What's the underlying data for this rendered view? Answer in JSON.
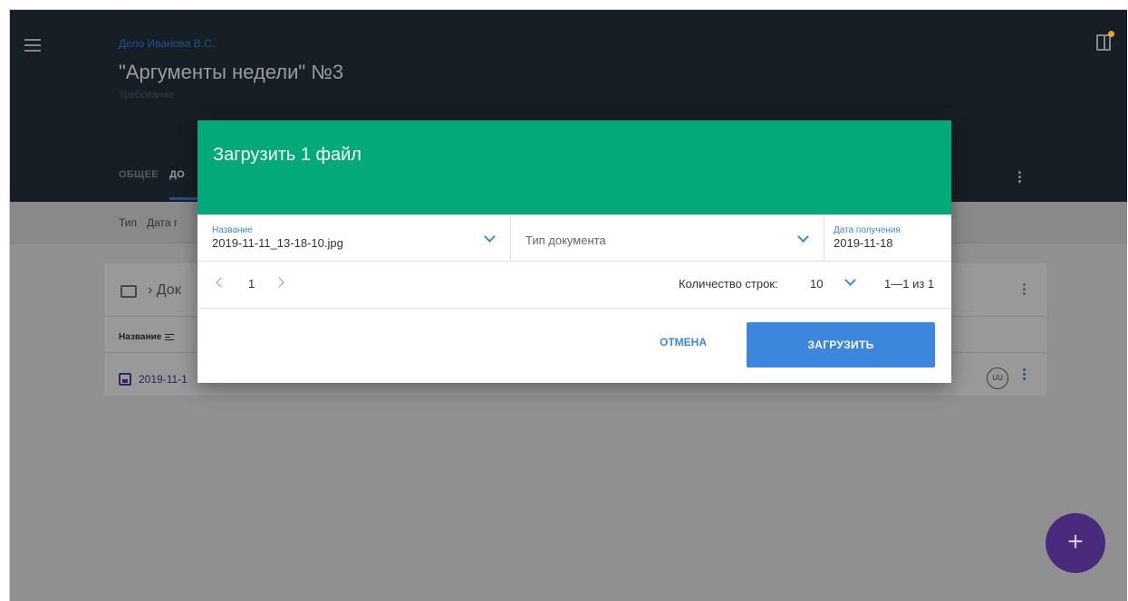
{
  "header": {
    "case_title": "Дело Иванова В.С.",
    "doc_title": "\"Аргументы недели\" №3",
    "doc_subtitle": "Требование",
    "tabs": [
      {
        "label": "ОБЩЕЕ"
      },
      {
        "label": "ДО"
      }
    ]
  },
  "filter_bar": {
    "items": [
      {
        "label": "Тип"
      },
      {
        "label": "Дата г"
      }
    ]
  },
  "list": {
    "breadcrumb": "› Док",
    "column_name": "Название",
    "row": {
      "file_name": "2019-11-1",
      "user_initials": "UU"
    }
  },
  "dialog": {
    "title": "Загрузить 1 файл",
    "name_field": {
      "label": "Название",
      "value": "2019-11-11_13-18-10.jpg"
    },
    "type_field": {
      "placeholder": "Тип документа"
    },
    "date_field": {
      "label": "Дата получения",
      "value": "2019-11-18"
    },
    "pager": {
      "page": "1",
      "rows_label": "Количество строк:",
      "rows_value": "10",
      "range": "1—1 из 1"
    },
    "cancel_label": "ОТМЕНА",
    "upload_label": "ЗАГРУЗИТЬ"
  },
  "fab": {
    "label": "+"
  },
  "colors": {
    "header_bg": "#263240",
    "dialog_header": "#04a97a",
    "accent": "#3d86de",
    "fab": "#4a2a7d"
  }
}
